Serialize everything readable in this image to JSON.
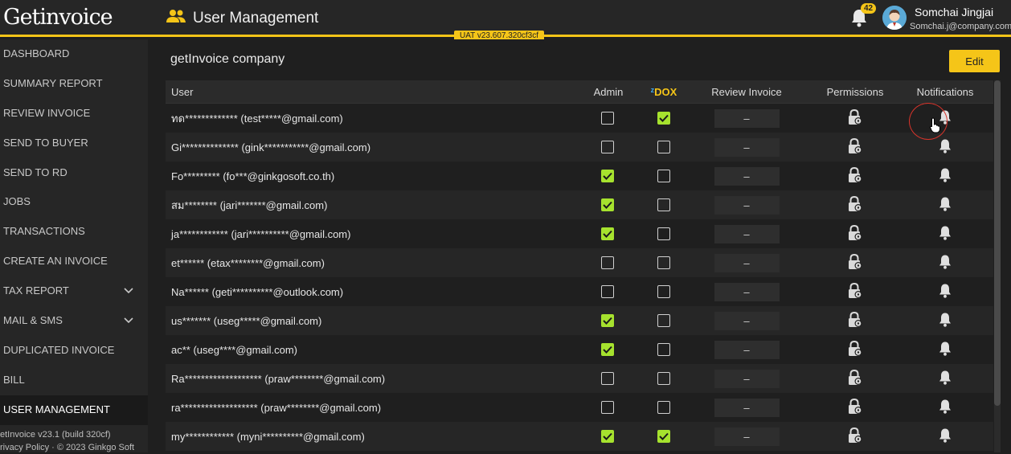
{
  "app": {
    "logo": "Getinvoice",
    "page_title": "User Management",
    "uat_badge": "UAT v23.607.320cf3cf"
  },
  "header": {
    "notification_count": "42",
    "user_name": "Somchai Jingjai",
    "user_email": "Somchai.j@company.com"
  },
  "sidebar": {
    "items": [
      {
        "label": "DASHBOARD"
      },
      {
        "label": "SUMMARY REPORT"
      },
      {
        "label": "REVIEW INVOICE"
      },
      {
        "label": "SEND TO BUYER"
      },
      {
        "label": "SEND TO RD"
      },
      {
        "label": "JOBS"
      },
      {
        "label": "TRANSACTIONS"
      },
      {
        "label": "CREATE AN INVOICE"
      },
      {
        "label": "TAX REPORT"
      },
      {
        "label": "MAIL & SMS"
      },
      {
        "label": "DUPLICATED INVOICE"
      },
      {
        "label": "BILL"
      },
      {
        "label": "USER MANAGEMENT"
      }
    ],
    "footer_version": "etInvoice v23.1 (build 320cf)",
    "footer_policy": "rivacy Policy  ·  © 2023 Ginkgo Soft"
  },
  "main": {
    "company_name": "getInvoice company",
    "edit_label": "Edit",
    "columns": {
      "user": "User",
      "admin": "Admin",
      "zdox_prefix": "z",
      "zdox": "DOX",
      "review": "Review Invoice",
      "permissions": "Permissions",
      "notifications": "Notifications"
    },
    "review_placeholder": "–",
    "rows": [
      {
        "user": "ทด************* (test*****@gmail.com)",
        "admin": false,
        "zdox": true
      },
      {
        "user": "Gi************** (gink***********@gmail.com)",
        "admin": false,
        "zdox": false
      },
      {
        "user": "Fo********* (fo***@ginkgosoft.co.th)",
        "admin": true,
        "zdox": false
      },
      {
        "user": "สม******** (jari*******@gmail.com)",
        "admin": true,
        "zdox": false
      },
      {
        "user": "ja************ (jari**********@gmail.com)",
        "admin": true,
        "zdox": false
      },
      {
        "user": "et****** (etax********@gmail.com)",
        "admin": false,
        "zdox": false
      },
      {
        "user": "Na****** (geti**********@outlook.com)",
        "admin": false,
        "zdox": false
      },
      {
        "user": "us******* (useg*****@gmail.com)",
        "admin": true,
        "zdox": false
      },
      {
        "user": "ac** (useg****@gmail.com)",
        "admin": true,
        "zdox": false
      },
      {
        "user": "Ra******************* (praw********@gmail.com)",
        "admin": false,
        "zdox": false
      },
      {
        "user": "ra******************* (praw********@gmail.com)",
        "admin": false,
        "zdox": false
      },
      {
        "user": "my************ (myni**********@gmail.com)",
        "admin": true,
        "zdox": true
      }
    ]
  },
  "colors": {
    "accent": "#f5c518",
    "check_on": "#a6e22e",
    "highlight_ring": "#d9342b"
  }
}
